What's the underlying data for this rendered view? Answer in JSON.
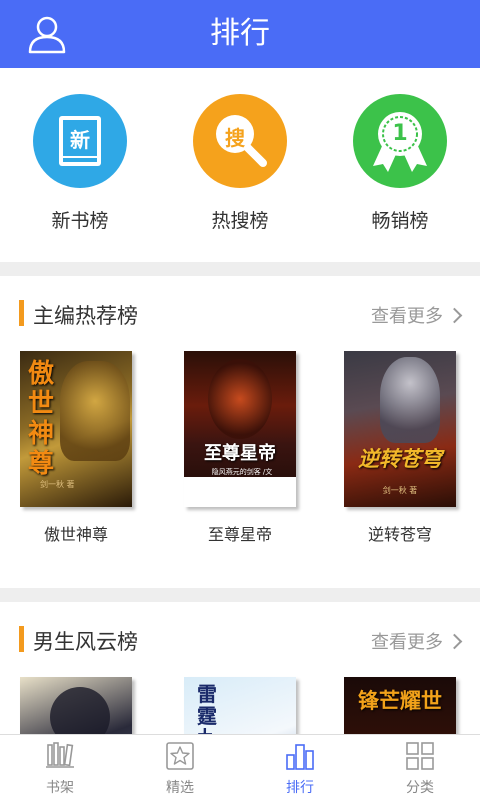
{
  "header": {
    "title": "排行",
    "user_icon": "user-icon"
  },
  "rank_categories": [
    {
      "label": "新书榜",
      "badge": "新",
      "color": "#2fa8e6"
    },
    {
      "label": "热搜榜",
      "badge": "搜",
      "color": "#f5a21c"
    },
    {
      "label": "畅销榜",
      "badge": "1",
      "color": "#3cc24a"
    }
  ],
  "sections": [
    {
      "title": "主编热荐榜",
      "more_label": "查看更多",
      "books": [
        {
          "name": "傲世神尊",
          "cover_text": "傲世神尊",
          "cover_author": "剑一秋 著"
        },
        {
          "name": "至尊星帝",
          "cover_text": "至尊星帝",
          "cover_author": "隐风燕元的剑客 /文"
        },
        {
          "name": "逆转苍穹",
          "cover_text": "逆转苍穹",
          "cover_author": "剑一秋 著"
        }
      ]
    },
    {
      "title": "男生风云榜",
      "more_label": "查看更多",
      "books": [
        {
          "cover_text": ""
        },
        {
          "cover_text": "雷霆九天"
        },
        {
          "cover_text": "锋芒耀世"
        }
      ]
    }
  ],
  "tabbar": [
    {
      "label": "书架",
      "icon": "bookshelf-icon"
    },
    {
      "label": "精选",
      "icon": "star-icon"
    },
    {
      "label": "排行",
      "icon": "ranking-icon",
      "active": true
    },
    {
      "label": "分类",
      "icon": "grid-icon"
    }
  ],
  "colors": {
    "brand": "#4a6cf6",
    "accent": "#f39a1e"
  }
}
